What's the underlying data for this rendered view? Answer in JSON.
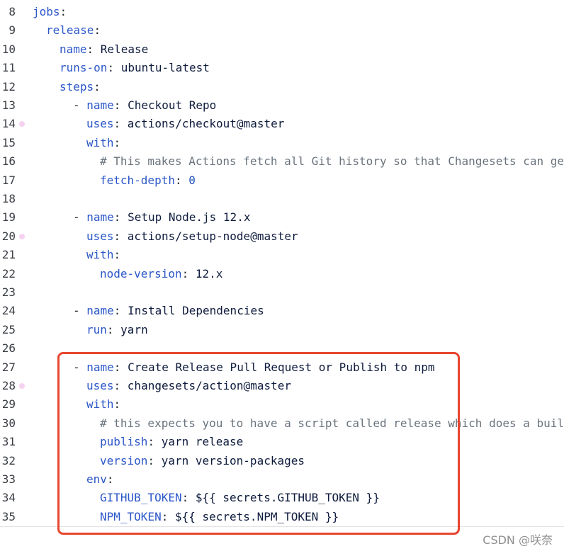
{
  "editor": {
    "lines": [
      {
        "num": "8",
        "indent": 0,
        "dot": false,
        "tokens": [
          {
            "t": "jobs",
            "c": "key"
          },
          {
            "t": ":",
            "c": "punct"
          }
        ]
      },
      {
        "num": "9",
        "indent": 1,
        "dot": false,
        "tokens": [
          {
            "t": "release",
            "c": "key"
          },
          {
            "t": ":",
            "c": "punct"
          }
        ]
      },
      {
        "num": "10",
        "indent": 2,
        "dot": false,
        "tokens": [
          {
            "t": "name",
            "c": "key"
          },
          {
            "t": ": ",
            "c": "punct"
          },
          {
            "t": "Release",
            "c": "str"
          }
        ]
      },
      {
        "num": "11",
        "indent": 2,
        "dot": false,
        "tokens": [
          {
            "t": "runs-on",
            "c": "key"
          },
          {
            "t": ": ",
            "c": "punct"
          },
          {
            "t": "ubuntu-latest",
            "c": "str"
          }
        ]
      },
      {
        "num": "12",
        "indent": 2,
        "dot": false,
        "tokens": [
          {
            "t": "steps",
            "c": "key"
          },
          {
            "t": ":",
            "c": "punct"
          }
        ]
      },
      {
        "num": "13",
        "indent": 3,
        "dot": false,
        "tokens": [
          {
            "t": "- ",
            "c": "punct"
          },
          {
            "t": "name",
            "c": "key"
          },
          {
            "t": ": ",
            "c": "punct"
          },
          {
            "t": "Checkout Repo",
            "c": "str"
          }
        ]
      },
      {
        "num": "14",
        "indent": 4,
        "dot": true,
        "tokens": [
          {
            "t": "uses",
            "c": "key"
          },
          {
            "t": ": ",
            "c": "punct"
          },
          {
            "t": "actions/checkout@master",
            "c": "str"
          }
        ]
      },
      {
        "num": "15",
        "indent": 4,
        "dot": false,
        "tokens": [
          {
            "t": "with",
            "c": "key"
          },
          {
            "t": ":",
            "c": "punct"
          }
        ]
      },
      {
        "num": "16",
        "indent": 5,
        "dot": false,
        "tokens": [
          {
            "t": "# This makes Actions fetch all Git history so that Changesets can gen",
            "c": "cmt"
          }
        ]
      },
      {
        "num": "17",
        "indent": 5,
        "dot": false,
        "tokens": [
          {
            "t": "fetch-depth",
            "c": "key"
          },
          {
            "t": ": ",
            "c": "punct"
          },
          {
            "t": "0",
            "c": "num"
          }
        ]
      },
      {
        "num": "18",
        "indent": 0,
        "dot": false,
        "tokens": []
      },
      {
        "num": "19",
        "indent": 3,
        "dot": false,
        "tokens": [
          {
            "t": "- ",
            "c": "punct"
          },
          {
            "t": "name",
            "c": "key"
          },
          {
            "t": ": ",
            "c": "punct"
          },
          {
            "t": "Setup Node.js 12.x",
            "c": "str"
          }
        ]
      },
      {
        "num": "20",
        "indent": 4,
        "dot": true,
        "tokens": [
          {
            "t": "uses",
            "c": "key"
          },
          {
            "t": ": ",
            "c": "punct"
          },
          {
            "t": "actions/setup-node@master",
            "c": "str"
          }
        ]
      },
      {
        "num": "21",
        "indent": 4,
        "dot": false,
        "tokens": [
          {
            "t": "with",
            "c": "key"
          },
          {
            "t": ":",
            "c": "punct"
          }
        ]
      },
      {
        "num": "22",
        "indent": 5,
        "dot": false,
        "tokens": [
          {
            "t": "node-version",
            "c": "key"
          },
          {
            "t": ": ",
            "c": "punct"
          },
          {
            "t": "12.x",
            "c": "str"
          }
        ]
      },
      {
        "num": "23",
        "indent": 0,
        "dot": false,
        "tokens": []
      },
      {
        "num": "24",
        "indent": 3,
        "dot": false,
        "tokens": [
          {
            "t": "- ",
            "c": "punct"
          },
          {
            "t": "name",
            "c": "key"
          },
          {
            "t": ": ",
            "c": "punct"
          },
          {
            "t": "Install Dependencies",
            "c": "str"
          }
        ]
      },
      {
        "num": "25",
        "indent": 4,
        "dot": false,
        "tokens": [
          {
            "t": "run",
            "c": "key"
          },
          {
            "t": ": ",
            "c": "punct"
          },
          {
            "t": "yarn",
            "c": "str"
          }
        ]
      },
      {
        "num": "26",
        "indent": 0,
        "dot": false,
        "tokens": []
      },
      {
        "num": "27",
        "indent": 3,
        "dot": false,
        "tokens": [
          {
            "t": "- ",
            "c": "punct"
          },
          {
            "t": "name",
            "c": "key"
          },
          {
            "t": ": ",
            "c": "punct"
          },
          {
            "t": "Create Release Pull Request or Publish to npm",
            "c": "str"
          }
        ]
      },
      {
        "num": "28",
        "indent": 4,
        "dot": true,
        "tokens": [
          {
            "t": "uses",
            "c": "key"
          },
          {
            "t": ": ",
            "c": "punct"
          },
          {
            "t": "changesets/action@master",
            "c": "str"
          }
        ]
      },
      {
        "num": "29",
        "indent": 4,
        "dot": false,
        "tokens": [
          {
            "t": "with",
            "c": "key"
          },
          {
            "t": ":",
            "c": "punct"
          }
        ]
      },
      {
        "num": "30",
        "indent": 5,
        "dot": false,
        "tokens": [
          {
            "t": "# this expects you to have a script called release which does a build",
            "c": "cmt"
          }
        ]
      },
      {
        "num": "31",
        "indent": 5,
        "dot": false,
        "tokens": [
          {
            "t": "publish",
            "c": "key"
          },
          {
            "t": ": ",
            "c": "punct"
          },
          {
            "t": "yarn release",
            "c": "str"
          }
        ]
      },
      {
        "num": "32",
        "indent": 5,
        "dot": false,
        "tokens": [
          {
            "t": "version",
            "c": "key"
          },
          {
            "t": ": ",
            "c": "punct"
          },
          {
            "t": "yarn version-packages",
            "c": "str"
          }
        ]
      },
      {
        "num": "33",
        "indent": 4,
        "dot": false,
        "tokens": [
          {
            "t": "env",
            "c": "key"
          },
          {
            "t": ":",
            "c": "punct"
          }
        ]
      },
      {
        "num": "34",
        "indent": 5,
        "dot": false,
        "tokens": [
          {
            "t": "GITHUB_TOKEN",
            "c": "key"
          },
          {
            "t": ": ",
            "c": "punct"
          },
          {
            "t": "${{ secrets.GITHUB_TOKEN }}",
            "c": "str"
          }
        ]
      },
      {
        "num": "35",
        "indent": 5,
        "dot": false,
        "tokens": [
          {
            "t": "NPM_TOKEN",
            "c": "key"
          },
          {
            "t": ": ",
            "c": "punct"
          },
          {
            "t": "${{ secrets.NPM_TOKEN }}",
            "c": "str"
          }
        ]
      }
    ]
  },
  "colors": {
    "highlight_border": "#e8452f",
    "gutter_dot": "#f5d2f0"
  },
  "watermark": {
    "text": "CSDN @咲奈"
  }
}
